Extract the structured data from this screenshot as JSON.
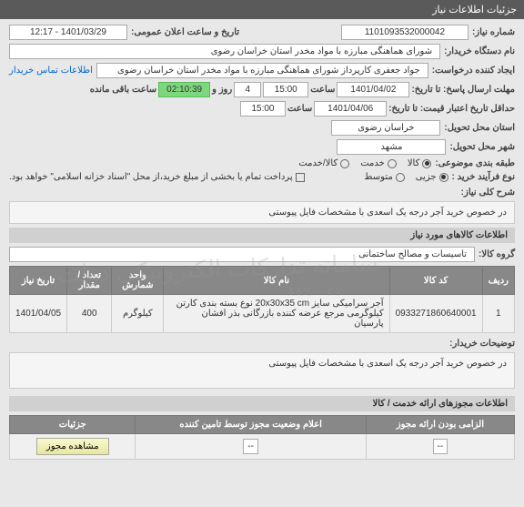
{
  "header": {
    "title": "جزئیات اطلاعات نیاز"
  },
  "need": {
    "number_label": "شماره نیاز:",
    "number": "1101093532000042",
    "date_label": "تاریخ و ساعت اعلان عمومی:",
    "date": "1401/03/29 - 12:17",
    "buyer_org_label": "نام دستگاه خریدار:",
    "buyer_org": "شورای هماهنگی مبارزه با مواد مخدر استان خراسان رضوی",
    "requester_label": "ایجاد کننده درخواست:",
    "requester": "جواد جعفری کارپرداز شورای هماهنگی مبارزه با مواد مخدر استان خراسان رضوی",
    "contact_link": "اطلاعات تماس خریدار",
    "deadline_label": "مهلت ارسال پاسخ: تا تاریخ:",
    "deadline_date": "1401/04/02",
    "deadline_time_label": "ساعت",
    "deadline_time": "15:00",
    "days_label": "روز و",
    "days": "4",
    "countdown": "02:10:39",
    "remaining_label": "ساعت باقی مانده",
    "min_valid_label": "حداقل تاریخ اعتبار قیمت: تا تاریخ:",
    "min_valid_date": "1401/04/06",
    "min_valid_time_label": "ساعت",
    "min_valid_time": "15:00",
    "province_label": "استان محل تحویل:",
    "province": "خراسان رضوی",
    "city_label": "شهر محل تحویل:",
    "city": "مشهد",
    "category_label": "طبقه بندی موضوعی:",
    "cat_goods": "کالا",
    "cat_service": "خدمت",
    "cat_both": "کالا/خدمت",
    "process_type_label": "نوع فرآیند خرید :",
    "proc_partial": "جزیی",
    "proc_medium": "متوسط",
    "payment_note": "پرداخت تمام یا بخشی از مبلغ خرید،از محل \"اسناد خزانه اسلامی\" خواهد بود."
  },
  "description": {
    "title_label": "شرح کلی نیاز:",
    "text": "در خصوص خرید آجر درجه یک اسعدی با مشخصات فایل پیوستی"
  },
  "goods": {
    "section_title": "اطلاعات کالاهای مورد نیاز",
    "group_label": "گروه کالا:",
    "group": "تاسیسات و مصالح ساختمانی",
    "headers": {
      "row": "ردیف",
      "code": "کد کالا",
      "name": "نام کالا",
      "unit": "واحد شمارش",
      "qty": "تعداد / مقدار",
      "date": "تاریخ نیاز"
    },
    "items": [
      {
        "row": "1",
        "code": "0933271860640001",
        "name": "آجر سرامیکی سایز 20x30x35 cm نوع بسته بندی کارتن کیلوگرمی مرجع عرضه کننده بازرگانی بذر افشان پارسیان",
        "unit": "کیلوگرم",
        "qty": "400",
        "date": "1401/04/05"
      }
    ]
  },
  "buyer_notes": {
    "label": "توضیحات خریدار:",
    "text": "در خصوص خرید آجر درجه یک اسعدی با مشخصات فایل پیوستی"
  },
  "authorizations": {
    "section_title": "اطلاعات مجوزهای ارائه خدمت / کالا",
    "headers": {
      "required": "الزامی بودن ارائه مجوز",
      "status": "اعلام وضعیت مجوز توسط تامین کننده",
      "details": "جزئیات"
    },
    "row": {
      "required_placeholder": "--",
      "status_placeholder": "--",
      "button": "مشاهده مجوز"
    }
  },
  "watermark": {
    "line1": "سامانه تدارکات الکترونیکی دولت",
    "line2": "۰۲۱–۸۸۹"
  }
}
